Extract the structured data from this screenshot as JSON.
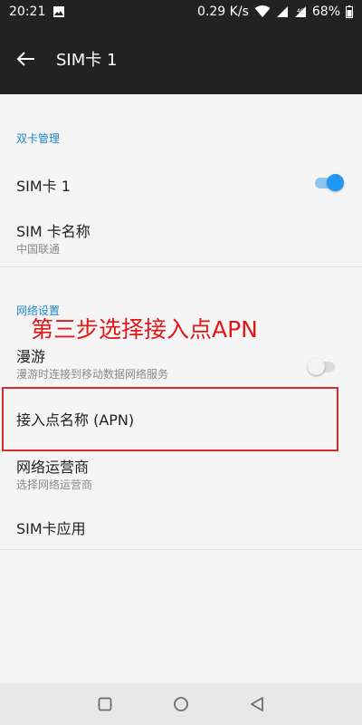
{
  "status_bar": {
    "time": "20:21",
    "speed": "0.29 K/s",
    "battery": "68%",
    "icons": [
      "image-icon",
      "wifi-icon",
      "signal-icon",
      "signal-icon",
      "battery-icon"
    ]
  },
  "app_bar": {
    "title": "SIM卡 1"
  },
  "dual_sim_section": {
    "header": "双卡管理",
    "sim1_toggle_label": "SIM卡 1",
    "sim1_enabled": true,
    "sim_name_label": "SIM 卡名称",
    "sim_name_value": "中国联通"
  },
  "network_section": {
    "header": "网络设置",
    "roaming_label": "漫游",
    "roaming_desc": "漫游时连接到移动数据网络服务",
    "roaming_enabled": false,
    "apn_label": "接入点名称 (APN)",
    "operator_label": "网络运营商",
    "operator_desc": "选择网络运营商",
    "sim_apps_label": "SIM卡应用"
  },
  "annotation": {
    "text": "第三步选择接入点APN",
    "color": "#e0181a"
  },
  "colors": {
    "accent": "#2196f3",
    "section_header": "#1e88c7",
    "app_bar": "#222222"
  }
}
